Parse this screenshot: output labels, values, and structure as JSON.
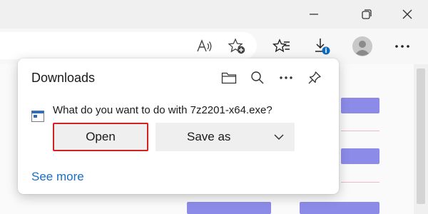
{
  "downloads": {
    "title": "Downloads",
    "prompt": "What do you want to do with 7z2201-x64.exe?",
    "open_label": "Open",
    "save_as_label": "Save as",
    "see_more_label": "See more"
  },
  "icons": {
    "window": [
      "minimize-icon",
      "restore-icon",
      "close-icon"
    ],
    "toolbar": [
      "read-aloud-icon",
      "add-favorite-icon",
      "favorites-icon",
      "downloads-icon",
      "profile-icon",
      "more-icon"
    ],
    "flyout": [
      "open-folder-icon",
      "search-icon",
      "more-options-icon",
      "pin-icon",
      "exe-file-icon",
      "chevron-down-icon"
    ]
  },
  "colors": {
    "accent_link": "#1a6fc4",
    "focus_outline": "#d61f1f",
    "download_badge": "#0f6cbd"
  }
}
